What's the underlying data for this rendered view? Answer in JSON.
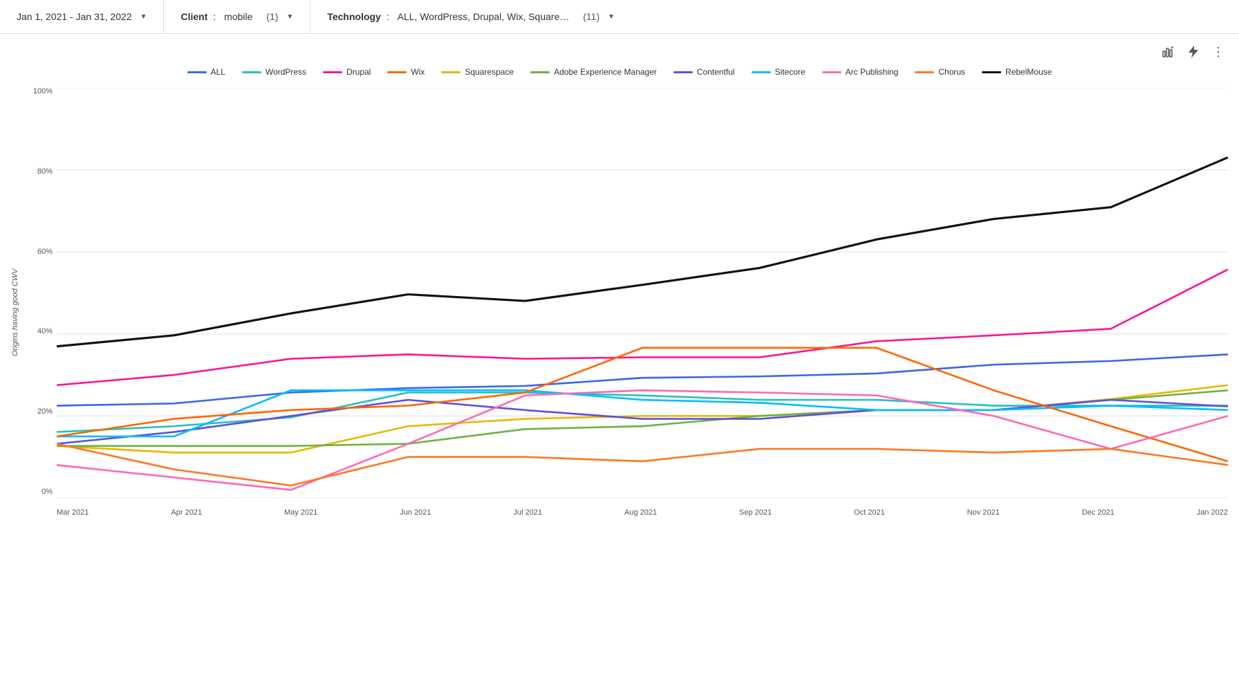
{
  "filters": {
    "date": {
      "label": "Jan 1, 2021 - Jan 31, 2022"
    },
    "client": {
      "label": "Client",
      "value": "mobile",
      "count": "(1)"
    },
    "technology": {
      "label": "Technology",
      "value": "ALL, WordPress, Drupal, Wix, Square…",
      "count": "(11)"
    }
  },
  "chart": {
    "y_axis_label": "Origins having good CWV",
    "y_labels": [
      "100%",
      "80%",
      "60%",
      "40%",
      "20%",
      "0%"
    ],
    "x_labels": [
      "Mar 2021",
      "Apr 2021",
      "May 2021",
      "Jun 2021",
      "Jul 2021",
      "Aug 2021",
      "Sep 2021",
      "Oct 2021",
      "Nov 2021",
      "Dec 2021",
      "Jan 2022"
    ]
  },
  "legend": [
    {
      "id": "all",
      "label": "ALL",
      "color": "#4169E1"
    },
    {
      "id": "wordpress",
      "label": "WordPress",
      "color": "#2ABFBF"
    },
    {
      "id": "drupal",
      "label": "Drupal",
      "color": "#FF1493"
    },
    {
      "id": "wix",
      "label": "Wix",
      "color": "#FF6600"
    },
    {
      "id": "squarespace",
      "label": "Squarespace",
      "color": "#E8B800"
    },
    {
      "id": "adobe",
      "label": "Adobe Experience Manager",
      "color": "#6DB33F"
    },
    {
      "id": "contentful",
      "label": "Contentful",
      "color": "#6050DC"
    },
    {
      "id": "sitecore",
      "label": "Sitecore",
      "color": "#00BFFF"
    },
    {
      "id": "arc",
      "label": "Arc Publishing",
      "color": "#FF69B4"
    },
    {
      "id": "chorus",
      "label": "Chorus",
      "color": "#FF7722"
    },
    {
      "id": "rebelmouse",
      "label": "RebelMouse",
      "color": "#111111"
    }
  ],
  "toolbar": {
    "chart_icon": "📊",
    "lightning_icon": "⚡",
    "more_icon": "⋮"
  }
}
